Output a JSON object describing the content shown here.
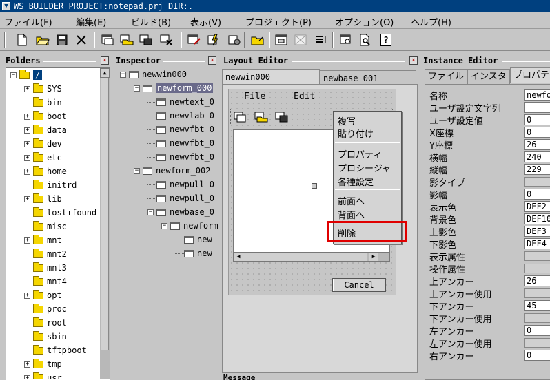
{
  "window": {
    "title": "WS BUILDER PROJECT:notepad.prj DIR:."
  },
  "menu": [
    "ファイル(F)",
    "編集(E)",
    "ビルド(B)",
    "表示(V)",
    "プロジェクト(P)",
    "オプション(O)",
    "ヘルプ(H)"
  ],
  "toolbar": {
    "icons": [
      "new-file-icon",
      "open-folder-icon",
      "save-icon",
      "close-x-icon",
      "window-icon",
      "open-window-icon",
      "save-window-icon",
      "close-window-icon",
      "edit-window-icon",
      "build-icon",
      "run-icon",
      "open-file-icon",
      "grid-icon",
      "align-icon",
      "list-icon",
      "preview-icon",
      "find-icon",
      "help-icon"
    ],
    "help_glyph": "?"
  },
  "folders": {
    "title": "Folders",
    "root": "/",
    "items": [
      "SYS",
      "bin",
      "boot",
      "data",
      "dev",
      "etc",
      "home",
      "initrd",
      "lib",
      "lost+found",
      "misc",
      "mnt",
      "mnt2",
      "mnt3",
      "mnt4",
      "opt",
      "proc",
      "root",
      "sbin",
      "tftpboot",
      "tmp",
      "usr"
    ]
  },
  "inspector": {
    "title": "Inspector",
    "nodes": [
      "newwin000",
      "newform_000",
      "newtext_0",
      "newvlab_0",
      "newvfbt_0",
      "newvfbt_0",
      "newvfbt_0",
      "newform_002",
      "newpull_0",
      "newpull_0",
      "newbase_0",
      "newform",
      "new",
      "new"
    ]
  },
  "layout": {
    "title": "Layout Editor",
    "tabs": [
      "newwin000",
      "newbase_001"
    ],
    "form_menu": [
      "File",
      "Edit"
    ],
    "cancel_label": "Cancel",
    "context_menu": [
      "複写",
      "貼り付け",
      "プロパティ",
      "プロシージャ",
      "各種設定",
      "前面へ",
      "背面へ",
      "削除"
    ],
    "highlight_color": "#e00000"
  },
  "instance": {
    "title": "Instance Editor",
    "tabs": [
      "ファイル",
      "インスタ",
      "プロパテ"
    ],
    "props": [
      {
        "label": "名称",
        "value": "newfo",
        "kind": "field"
      },
      {
        "label": "ユーザ設定文字列",
        "value": "",
        "kind": "field"
      },
      {
        "label": "ユーザ設定値",
        "value": "0",
        "kind": "field"
      },
      {
        "label": "X座標",
        "value": "0",
        "kind": "field"
      },
      {
        "label": "Y座標",
        "value": "26",
        "kind": "field"
      },
      {
        "label": "横幅",
        "value": "240",
        "kind": "field"
      },
      {
        "label": "縦幅",
        "value": "229",
        "kind": "field"
      },
      {
        "label": "影タイプ",
        "value": "",
        "kind": "button"
      },
      {
        "label": "影幅",
        "value": "0",
        "kind": "field"
      },
      {
        "label": "表示色",
        "value": "DEF2",
        "kind": "field"
      },
      {
        "label": "背景色",
        "value": "DEF10",
        "kind": "field"
      },
      {
        "label": "上影色",
        "value": "DEF3",
        "kind": "field"
      },
      {
        "label": "下影色",
        "value": "DEF4",
        "kind": "field"
      },
      {
        "label": "表示属性",
        "value": "",
        "kind": "button"
      },
      {
        "label": "操作属性",
        "value": "",
        "kind": "button"
      },
      {
        "label": "上アンカー",
        "value": "26",
        "kind": "field"
      },
      {
        "label": "上アンカー使用",
        "value": "",
        "kind": "button"
      },
      {
        "label": "下アンカー",
        "value": "45",
        "kind": "field"
      },
      {
        "label": "下アンカー使用",
        "value": "",
        "kind": "button"
      },
      {
        "label": "左アンカー",
        "value": "0",
        "kind": "field"
      },
      {
        "label": "左アンカー使用",
        "value": "",
        "kind": "button"
      },
      {
        "label": "右アンカー",
        "value": "0",
        "kind": "field"
      }
    ]
  },
  "message": {
    "title": "Message"
  }
}
